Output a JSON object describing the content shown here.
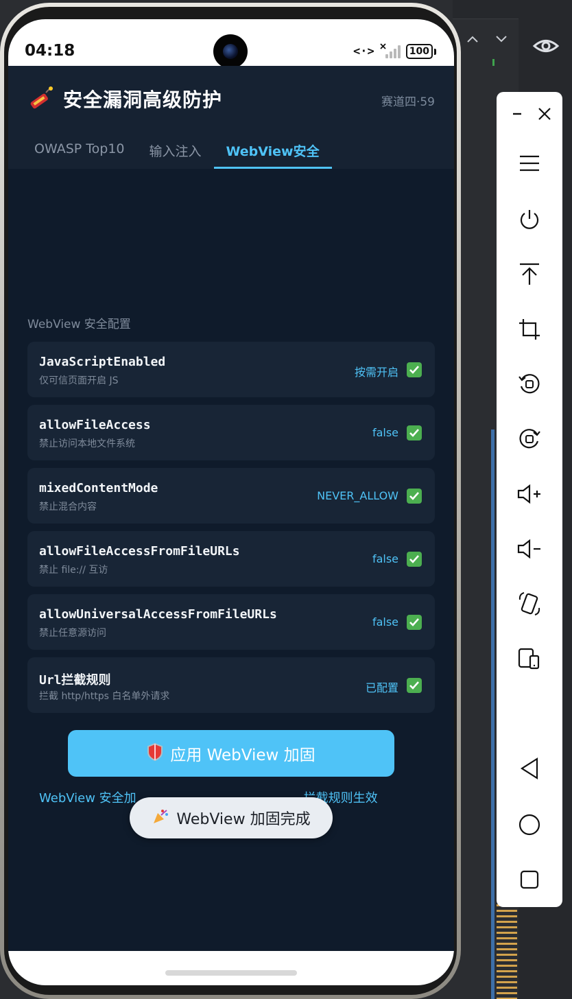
{
  "status_bar": {
    "time": "04:18",
    "net_code": "<·>",
    "battery": "100"
  },
  "header": {
    "title": "安全漏洞高级防护",
    "subtitle": "赛道四·59",
    "title_icon": "firecracker-icon"
  },
  "tabs": [
    {
      "label": "OWASP Top10",
      "active": false
    },
    {
      "label": "输入注入",
      "active": false
    },
    {
      "label": "WebView安全",
      "active": true
    }
  ],
  "section": {
    "label": "WebView 安全配置"
  },
  "settings": [
    {
      "name": "JavaScriptEnabled",
      "desc": "仅可信页面开启 JS",
      "value": "按需开启",
      "checked": true
    },
    {
      "name": "allowFileAccess",
      "desc": "禁止访问本地文件系统",
      "value": "false",
      "checked": true
    },
    {
      "name": "mixedContentMode",
      "desc": "禁止混合内容",
      "value": "NEVER_ALLOW",
      "checked": true
    },
    {
      "name": "allowFileAccessFromFileURLs",
      "desc": "禁止 file:// 互访",
      "value": "false",
      "checked": true
    },
    {
      "name": "allowUniversalAccessFromFileURLs",
      "desc": "禁止任意源访问",
      "value": "false",
      "checked": true
    },
    {
      "name": "Url拦截规则",
      "desc": "拦截 http/https 白名单外请求",
      "value": "已配置",
      "checked": true
    }
  ],
  "apply_button": {
    "label": "应用 WebView 加固",
    "icon": "shield-icon"
  },
  "status_line": {
    "left": "WebView 安全加",
    "right": "拦截规则生效"
  },
  "toast": {
    "text": "WebView 加固完成",
    "icon": "party-popper-icon"
  },
  "colors": {
    "accent": "#4fc3f7",
    "background": "#0f1b2b",
    "card": "#182536",
    "check": "#4caf50"
  }
}
